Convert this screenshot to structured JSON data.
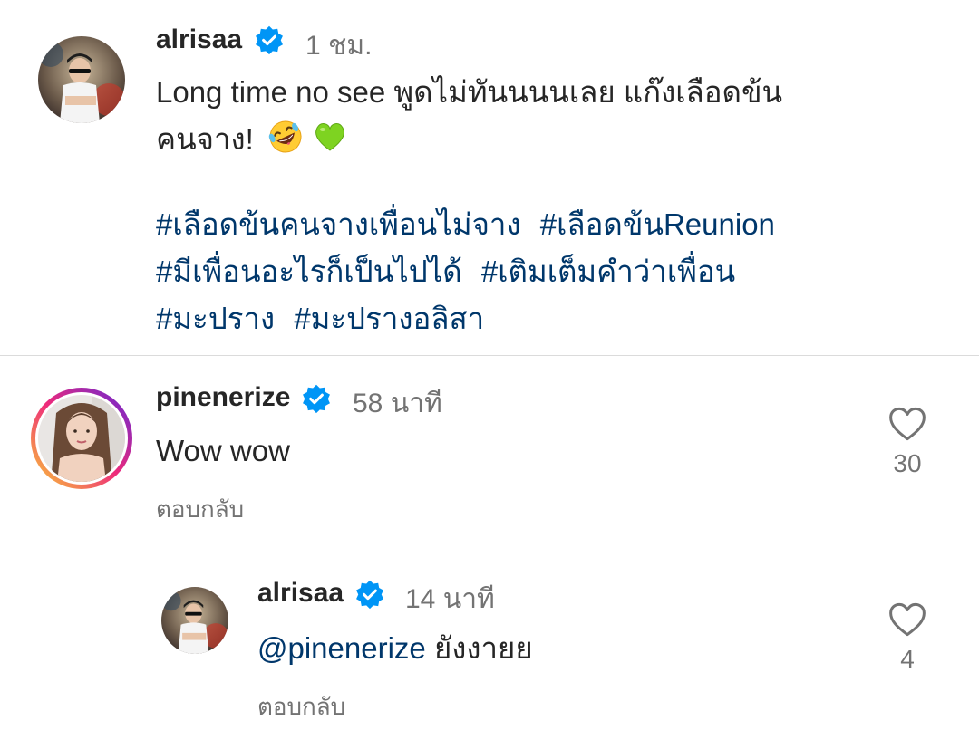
{
  "post": {
    "username": "alrisaa",
    "time": "1 ชม.",
    "caption_line1": "Long time no see พูดไม่ทันนนนเลย แก๊งเลือดข้น",
    "caption_line2": "คนจาง!",
    "emojis": [
      "rofl-emoji",
      "green-heart-emoji"
    ],
    "hashtags_line1": [
      "#เลือดข้นคนจางเพื่อนไม่จาง",
      "#เลือดข้นReunion"
    ],
    "hashtags_line2": [
      "#มีเพื่อนอะไรก็เป็นไปได้",
      "#เติมเต็มคำว่าเพื่อน"
    ],
    "hashtags_line3": [
      "#มะปราง",
      "#มะปรางอลิสา"
    ]
  },
  "comments": [
    {
      "username": "pinenerize",
      "time": "58 นาที",
      "text": "Wow wow",
      "reply_label": "ตอบกลับ",
      "likes": "30",
      "has_story_ring": true
    }
  ],
  "replies": [
    {
      "username": "alrisaa",
      "time": "14 นาที",
      "mention": "@pinenerize",
      "text": " ยังงายย",
      "reply_label": "ตอบกลับ",
      "likes": "4"
    }
  ],
  "colors": {
    "verified": "#0095f6",
    "hashtag": "#00376b",
    "secondary_text": "#737373",
    "story_ring_start": "#f9ce34",
    "story_ring_mid": "#ee2a7b",
    "story_ring_end": "#6228d7"
  }
}
